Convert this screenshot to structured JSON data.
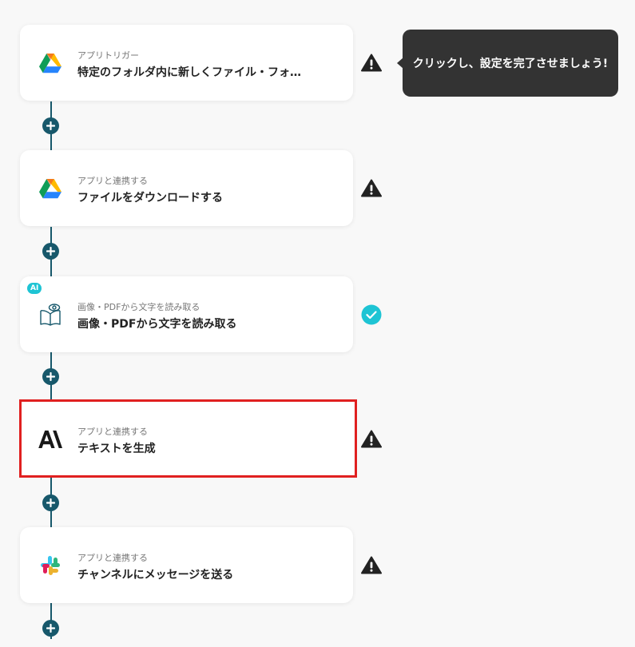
{
  "steps": [
    {
      "subtitle": "アプリトリガー",
      "title": "特定のフォルダ内に新しくファイル・フォ…",
      "app_icon": "google-drive-icon",
      "status": "warning"
    },
    {
      "subtitle": "アプリと連携する",
      "title": "ファイルをダウンロードする",
      "app_icon": "google-drive-icon",
      "status": "warning"
    },
    {
      "subtitle": "画像・PDFから文字を読み取る",
      "title": "画像・PDFから文字を読み取る",
      "app_icon": "ocr-book-eye-icon",
      "status": "complete",
      "badge": "AI"
    },
    {
      "subtitle": "アプリと連携する",
      "title": "テキストを生成",
      "app_icon": "anthropic-logo-icon",
      "status": "warning",
      "selected": true
    },
    {
      "subtitle": "アプリと連携する",
      "title": "チャンネルにメッセージを送る",
      "app_icon": "slack-icon",
      "status": "warning"
    }
  ],
  "tooltip": {
    "text": "クリックし、設定を完了させましょう!"
  },
  "colors": {
    "connector": "#17586b",
    "selected_border": "#e02020",
    "complete_badge": "#1ec4d4",
    "warning": "#222222",
    "tooltip_bg": "#333333"
  }
}
